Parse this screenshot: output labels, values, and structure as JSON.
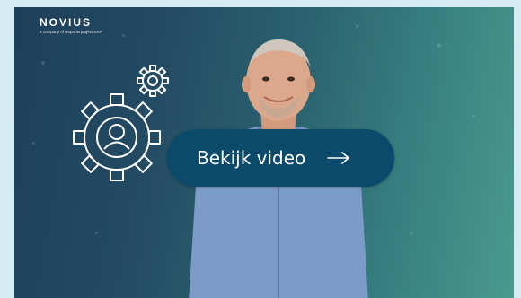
{
  "brand": {
    "name": "NOVIUS",
    "tagline": "a company of Reporterproject ERP"
  },
  "video": {
    "button_label": "Bekijk video",
    "arrow_icon": "arrow-right-icon",
    "button_color": "#0c4a6c"
  },
  "icons": {
    "graphic": "user-gears-icon"
  },
  "colors": {
    "page_background": "#d4ecf1",
    "gradient_start": "#1f3f5a",
    "gradient_end": "#4a9a8e"
  }
}
